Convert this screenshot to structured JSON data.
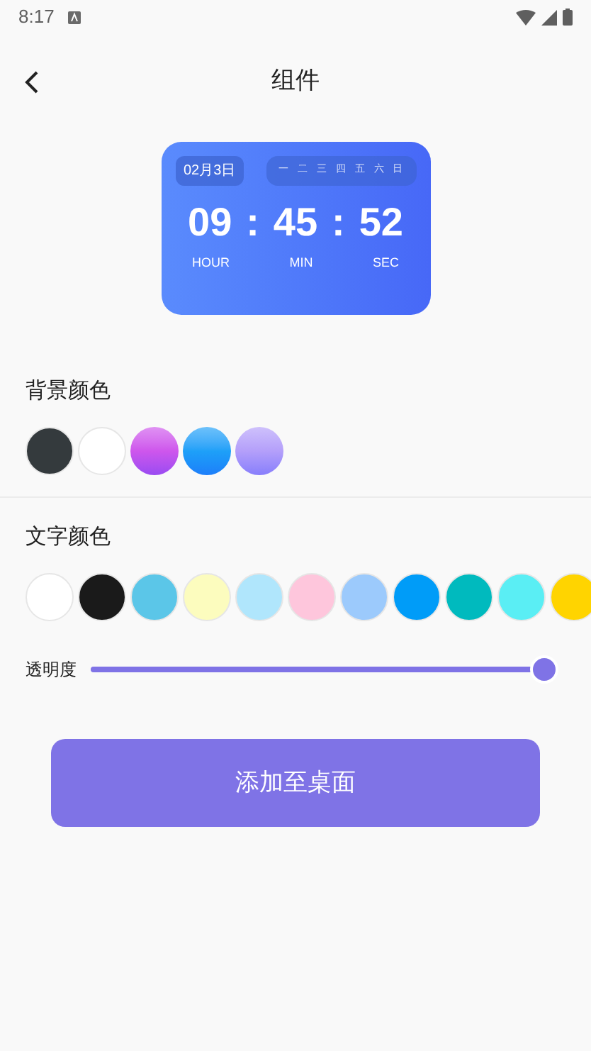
{
  "status_bar": {
    "time": "8:17"
  },
  "header": {
    "title": "组件"
  },
  "widget": {
    "date": "02月3日",
    "weekdays": [
      "一",
      "二",
      "三",
      "四",
      "五",
      "六",
      "日"
    ],
    "hours": "09",
    "minutes": "45",
    "seconds": "52",
    "separator": ":",
    "hour_label": "HOUR",
    "minute_label": "MIN",
    "second_label": "SEC"
  },
  "background_color": {
    "label": "背景颜色",
    "swatches": [
      {
        "color": "#343a3d"
      },
      {
        "color": "#ffffff"
      },
      {
        "color": "#ce56ec",
        "gradient": true
      },
      {
        "color": "#1ea0f8",
        "gradient": true
      },
      {
        "color": "#b49ffa",
        "gradient": true
      }
    ]
  },
  "text_color": {
    "label": "文字颜色",
    "swatches": [
      {
        "color": "#ffffff"
      },
      {
        "color": "#1a1a1a"
      },
      {
        "color": "#5bc6e8"
      },
      {
        "color": "#fcfcbe"
      },
      {
        "color": "#b0e6fc"
      },
      {
        "color": "#fec6dc"
      },
      {
        "color": "#9ccafc"
      },
      {
        "color": "#009cf8"
      },
      {
        "color": "#00babe"
      },
      {
        "color": "#5aeef4"
      },
      {
        "color": "#ffd400"
      }
    ]
  },
  "opacity": {
    "label": "透明度",
    "level": 1.0
  },
  "add_button": {
    "label": "添加至桌面"
  }
}
